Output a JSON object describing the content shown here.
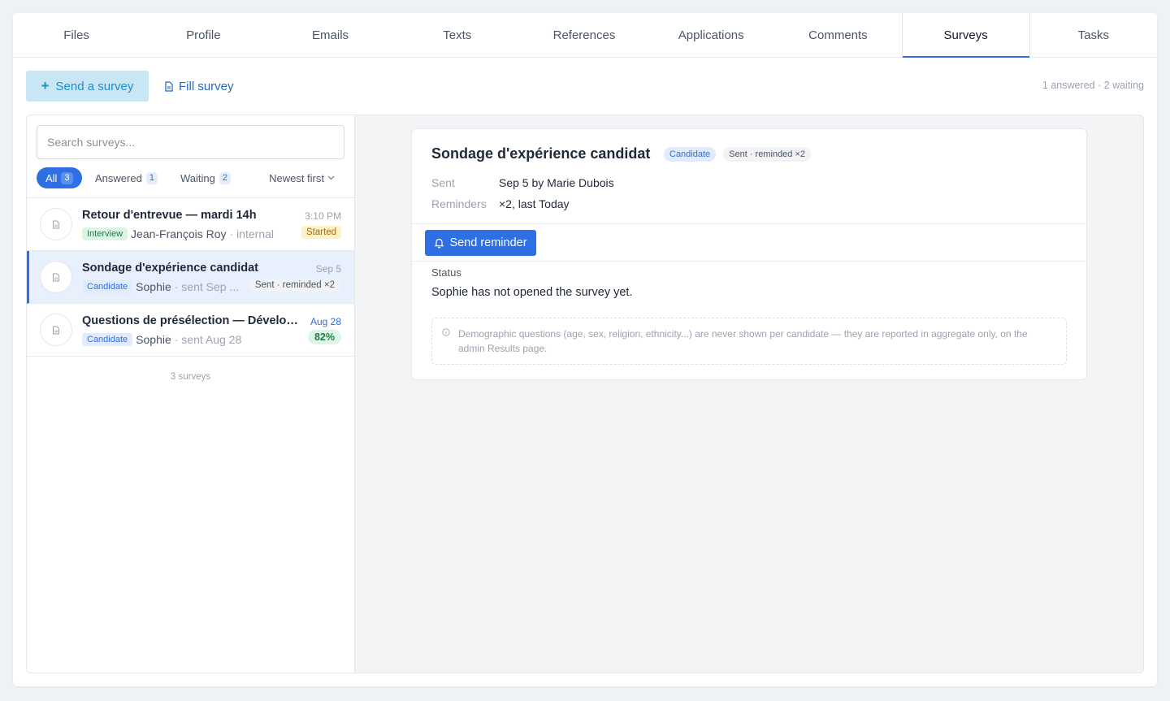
{
  "tabs": [
    "Files",
    "Profile",
    "Emails",
    "Texts",
    "References",
    "Applications",
    "Comments",
    "Surveys",
    "Tasks"
  ],
  "active_tab": "Surveys",
  "toolbar": {
    "send_label": "Send a survey",
    "fill_label": "Fill survey",
    "summary": "1 answered · 2 waiting"
  },
  "search": {
    "placeholder": "Search surveys..."
  },
  "filters": {
    "all_label": "All",
    "all_count": "3",
    "answered_label": "Answered",
    "answered_count": "1",
    "waiting_label": "Waiting",
    "waiting_count": "2",
    "sort_label": "Newest first"
  },
  "surveys": [
    {
      "title": "Retour d'entrevue — mardi 14h",
      "time": "3:10 PM",
      "tag": "Interview",
      "person": "Jean-François Roy",
      "extra": "· internal",
      "badge": "Started"
    },
    {
      "title": "Sondage d'expérience candidat",
      "time": "Sep 5",
      "tag": "Candidate",
      "person": "Sophie",
      "extra": "· sent Sep ...",
      "badge": "Sent · reminded ×2"
    },
    {
      "title": "Questions de présélection — Développeur",
      "time": "Aug 28",
      "tag": "Candidate",
      "person": "Sophie",
      "extra": "· sent Aug 28",
      "badge": "82%"
    }
  ],
  "list_count": "3 surveys",
  "detail": {
    "title": "Sondage d'expérience candidat",
    "tag_candidate": "Candidate",
    "tag_status": "Sent · reminded ×2",
    "sent_label": "Sent",
    "sent_value": "Sep 5 by Marie Dubois",
    "reminders_label": "Reminders",
    "reminders_value": "×2, last Today",
    "remind_button": "Send reminder",
    "status_label": "Status",
    "status_text": "Sophie has not opened the survey yet.",
    "note": "Demographic questions (age, sex, religion, ethnicity...) are never shown per candidate — they are reported in aggregate only, on the admin Results page."
  }
}
